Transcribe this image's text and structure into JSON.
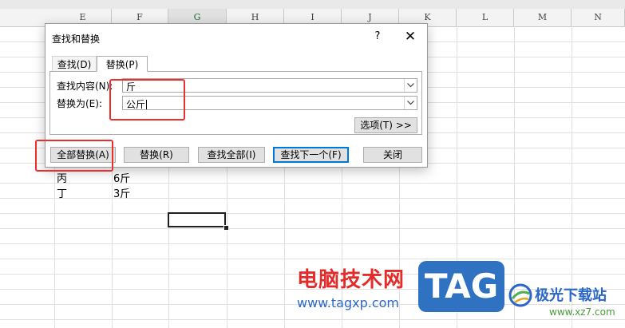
{
  "spreadsheet": {
    "columns": [
      "E",
      "F",
      "G",
      "H",
      "I",
      "J",
      "K",
      "L",
      "M",
      "N"
    ],
    "active_column": "G",
    "cells": [
      {
        "text": "丙"
      },
      {
        "text": "6斤"
      },
      {
        "text": "丁"
      },
      {
        "text": "3斤"
      }
    ]
  },
  "dialog": {
    "title": "查找和替换",
    "help": "?",
    "close": "✕",
    "tabs": [
      "查找(D)",
      "替换(P)"
    ],
    "active_tab": "替换(P)",
    "find_label": "查找内容(N):",
    "find_value": "斤",
    "replace_label": "替换为(E):",
    "replace_value": "公斤",
    "options_button": "选项(T) >>",
    "buttons": {
      "replace_all": "全部替换(A)",
      "replace": "替换(R)",
      "find_all": "查找全部(I)",
      "find_next": "查找下一个(F)",
      "close": "关闭"
    }
  },
  "watermark": {
    "site_name": "电脑技术网",
    "url": "www.tagxp.com",
    "tag": "TAG",
    "brand2": "极光下载站",
    "url2": "www.xz7.com"
  },
  "colors": {
    "highlight_red": "#e8312f",
    "excel_green": "#217346",
    "default_button_blue": "#0078d7",
    "watermark_red": "#e52a2a",
    "watermark_blue": "#2f72c2"
  }
}
